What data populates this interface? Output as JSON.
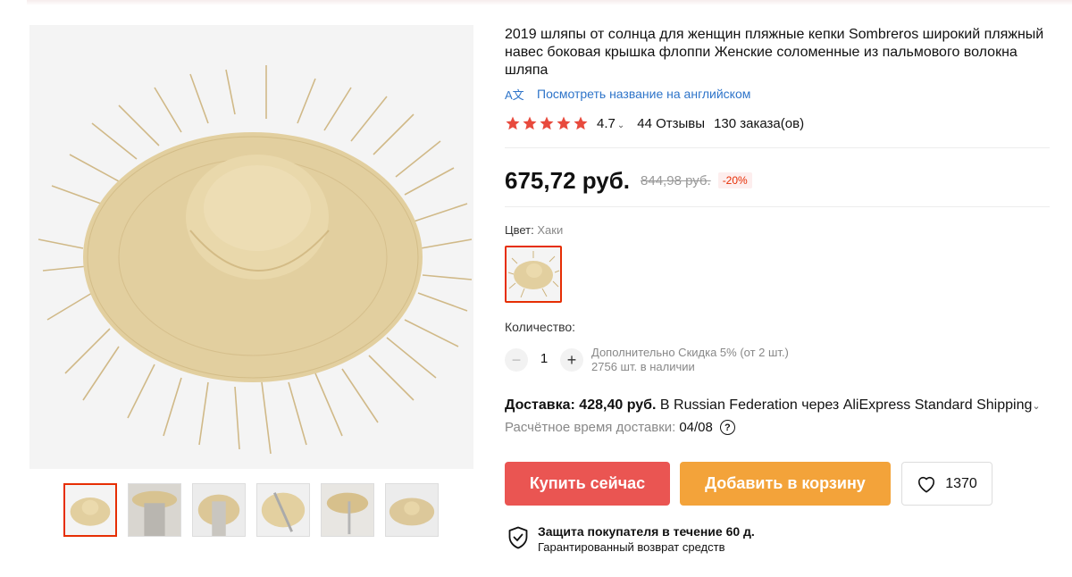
{
  "product": {
    "title": "2019 шляпы от солнца для женщин пляжные кепки Sombreros широкий пляжный навес боковая крышка флоппи Женские соломенные из пальмового волокна шляпа",
    "translate_link": "Посмотреть название на английском",
    "translate_icon_label": "A文"
  },
  "rating": {
    "stars": 5,
    "value": "4.7",
    "reviews": "44 Отзывы",
    "orders": "130 заказа(ов)"
  },
  "price": {
    "current": "675,72 руб.",
    "old": "844,98 руб.",
    "discount": "-20%"
  },
  "color": {
    "label": "Цвет:",
    "value": "Хаки"
  },
  "quantity": {
    "label": "Количество:",
    "minus": "−",
    "value": "1",
    "plus": "+",
    "discount_note": "Дополнительно Скидка 5% (от 2 шт.)",
    "stock": "2756 шт. в наличии"
  },
  "delivery": {
    "label": "Доставка: 428,40 руб.",
    "route": " В Russian Federation через AliExpress Standard Shipping",
    "eta_label": "Расчётное время доставки:",
    "eta_date": "04/08",
    "help": "?"
  },
  "buttons": {
    "buy_now": "Купить сейчас",
    "add_to_cart": "Добавить в корзину",
    "wishlist_count": "1370"
  },
  "protection": {
    "title": "Защита покупателя в течение 60 д.",
    "subtitle": "Гарантированный возврат средств"
  },
  "colors": {
    "accent_red": "#e62e04",
    "buy_button": "#ea5552",
    "cart_button": "#f3a33a",
    "link_blue": "#2e74c9",
    "star": "#e84a3d"
  }
}
